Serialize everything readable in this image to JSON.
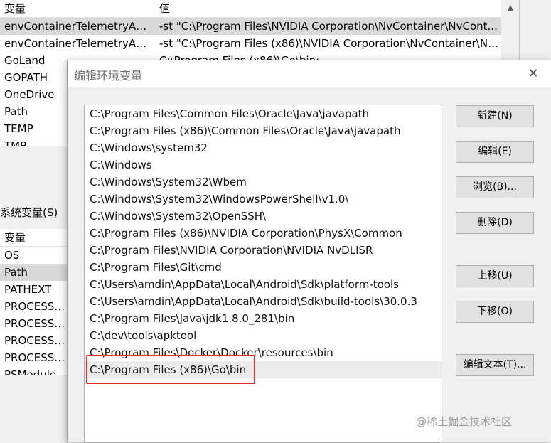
{
  "background": {
    "user_table": {
      "headers": [
        "变量",
        "值"
      ],
      "rows": [
        {
          "name": "envContainerTelemetryApi...",
          "value": "-st \"C:\\Program Files\\NVIDIA Corporation\\NvContainer\\NvCont...",
          "selected": true
        },
        {
          "name": "envContainerTelemetryApi...",
          "value": "-st \"C:\\Program Files (x86)\\NVIDIA Corporation\\NvContainer\\Nv...",
          "selected": false
        },
        {
          "name": "GoLand",
          "value": "C:\\Program Files (x86)\\Go\\bin;",
          "selected": false
        },
        {
          "name": "GOPATH",
          "value": "",
          "selected": false
        },
        {
          "name": "OneDrive",
          "value": "",
          "selected": false
        },
        {
          "name": "Path",
          "value": "",
          "selected": false
        },
        {
          "name": "TEMP",
          "value": "",
          "selected": false
        },
        {
          "name": "TMP",
          "value": "",
          "selected": false
        }
      ]
    },
    "system_label": "系统变量(S)",
    "system_table": {
      "header": "变量",
      "rows": [
        "OS",
        "Path",
        "PATHEXT",
        "PROCESSOR",
        "PROCESSOR",
        "PROCESSOR",
        "PROCESSOR",
        "PSModulePa"
      ],
      "selected_index": 1
    }
  },
  "dialog": {
    "title": "编辑环境变量",
    "close_glyph": "✕",
    "paths": [
      "C:\\Program Files\\Common Files\\Oracle\\Java\\javapath",
      "C:\\Program Files (x86)\\Common Files\\Oracle\\Java\\javapath",
      "C:\\Windows\\system32",
      "C:\\Windows",
      "C:\\Windows\\System32\\Wbem",
      "C:\\Windows\\System32\\WindowsPowerShell\\v1.0\\",
      "C:\\Windows\\System32\\OpenSSH\\",
      "C:\\Program Files (x86)\\NVIDIA Corporation\\PhysX\\Common",
      "C:\\Program Files\\NVIDIA Corporation\\NVIDIA NvDLISR",
      "C:\\Program Files\\Git\\cmd",
      "C:\\Users\\amdin\\AppData\\Local\\Android\\Sdk\\platform-tools",
      "C:\\Users\\amdin\\AppData\\Local\\Android\\Sdk\\build-tools\\30.0.3",
      "C:\\Program Files\\Java\\jdk1.8.0_281\\bin",
      "C:\\dev\\tools\\apktool",
      "C:\\Program Files\\Docker\\Docker\\resources\\bin",
      "C:\\Program Files (x86)\\Go\\bin"
    ],
    "selected_path_index": 15,
    "buttons": {
      "new": "新建(N)",
      "edit": "编辑(E)",
      "browse": "浏览(B)...",
      "delete": "删除(D)",
      "move_up": "上移(U)",
      "move_down": "下移(O)",
      "edit_text": "编辑文本(T)..."
    },
    "highlight_color": "#e03030"
  },
  "watermark": "@稀土掘金技术社区"
}
